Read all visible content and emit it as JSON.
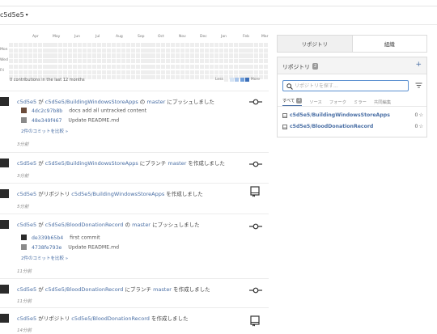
{
  "header": {
    "username": "c5d5e5"
  },
  "heatmap": {
    "months": [
      "Apr",
      "May",
      "Jun",
      "Jul",
      "Aug",
      "Sep",
      "Oct",
      "Nov",
      "Dec",
      "Jan",
      "Feb",
      "Mar"
    ],
    "days": [
      "Mon",
      "Wed",
      "Fri"
    ],
    "summary": "0 contributions in the last 12 months",
    "legend_less": "Less",
    "legend_more": "More",
    "colors": [
      "#eeeeee",
      "#d6e4f4",
      "#a9c5ea",
      "#6f9fdc",
      "#3c6fb8"
    ]
  },
  "feed": [
    {
      "user": "c5d5e5",
      "parts": [
        "が",
        "c5d5e5/BuildingWindowsStoreApps",
        "の",
        "master",
        "にプッシュしました"
      ],
      "commits": [
        {
          "sha": "4dc2c97b8b",
          "message": "docs add all untracked content"
        },
        {
          "sha": "48e349f467",
          "message": "Update README.md"
        }
      ],
      "more": "2件のコミットを比較 »",
      "time": "3分前",
      "icon": "commit-icon"
    },
    {
      "user": "c5d5e5",
      "parts": [
        "が",
        "c5d5e5/BuildingWindowsStoreApps",
        "にブランチ",
        "master",
        "を作成しました"
      ],
      "time": "3分前",
      "icon": "commit-icon"
    },
    {
      "user": "c5d5e5",
      "parts": [
        "がリポジトリ",
        "c5d5e5/BuildingWindowsStoreApps",
        "を作成しました"
      ],
      "time": "5分前",
      "icon": "repo-icon"
    },
    {
      "user": "c5d5e5",
      "parts": [
        "が",
        "c5d5e5/BloodDonationRecord",
        "の",
        "master",
        "にプッシュしました"
      ],
      "commits": [
        {
          "sha": "de339b65b4",
          "message": "first commit"
        },
        {
          "sha": "4738fe793e",
          "message": "Update README.md"
        }
      ],
      "more": "2件のコミットを比較 »",
      "time": "11分前",
      "icon": "commit-icon"
    },
    {
      "user": "c5d5e5",
      "parts": [
        "が",
        "c5d5e5/BloodDonationRecord",
        "にブランチ",
        "master",
        "を作成しました"
      ],
      "time": "11分前",
      "icon": "commit-icon"
    },
    {
      "user": "c5d5e5",
      "parts": [
        "がリポジトリ",
        "c5d5e5/BloodDonationRecord",
        "を作成しました"
      ],
      "time": "14分前",
      "icon": "repo-icon"
    }
  ],
  "sidebar": {
    "tabs": [
      "リポジトリ",
      "組織"
    ],
    "panel_title": "リポジトリ",
    "repo_count": "2",
    "add_label": "+",
    "search_placeholder": "リポジトリを探す...",
    "filters": [
      "すべて",
      "ソース",
      "フォーク",
      "ミラー",
      "共同編集"
    ],
    "filter_all_count": "2",
    "repos": [
      {
        "name": "c5d5e5/BuildingWindowsStoreApps",
        "stars": "0"
      },
      {
        "name": "c5d5e5/BloodDonationRecord",
        "stars": "0"
      }
    ]
  }
}
